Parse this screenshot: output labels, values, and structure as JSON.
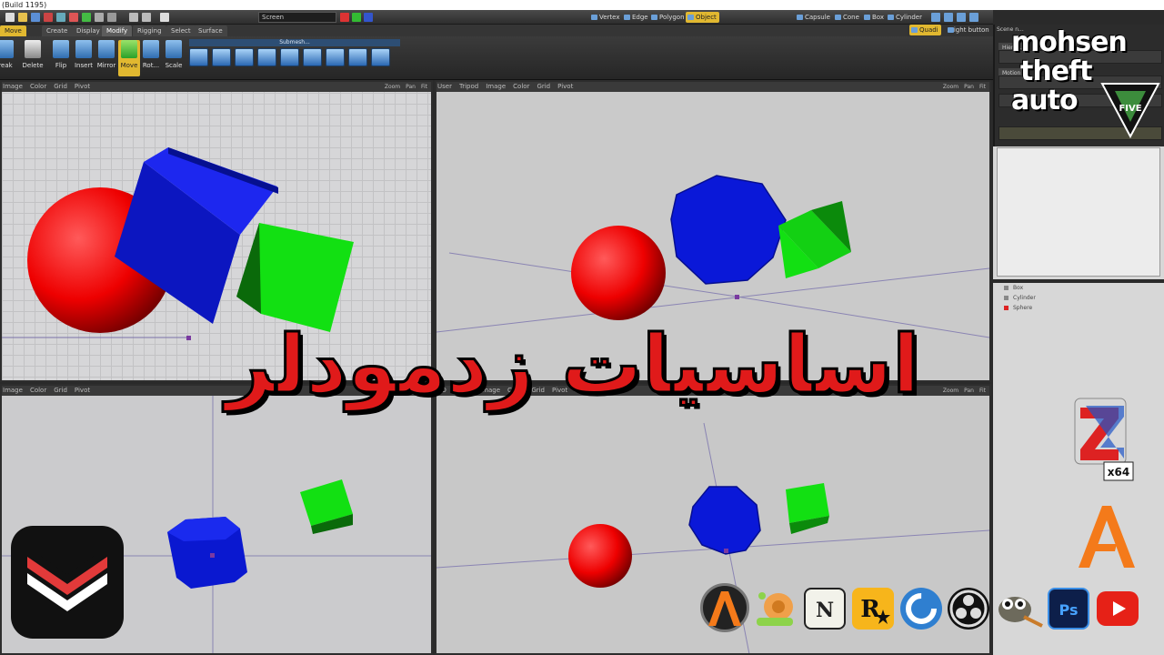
{
  "window": {
    "title": "(Build 1195)"
  },
  "toolbar": {
    "screen_select": "Screen",
    "buttons": [
      "Vertex",
      "Edge",
      "Polygon",
      "Object"
    ],
    "primitives": [
      "Capsule",
      "Cone",
      "Box",
      "Cylinder"
    ],
    "active": "Object",
    "quad_label": "Quadi",
    "right_button_label": "Right button"
  },
  "tabs": [
    "Move",
    "Create",
    "Display",
    "Modify",
    "Rigging",
    "Select",
    "Surface"
  ],
  "ribbon": {
    "tools": [
      "reak",
      "Delete",
      "Flip",
      "Insert",
      "Mirror",
      "Move",
      "Rot...",
      "Scale"
    ],
    "submesh_label": "Submesh..."
  },
  "viewports": {
    "top_left": {
      "items": [
        "Image",
        "Color",
        "Grid",
        "Pivot"
      ]
    },
    "top_right": {
      "items": [
        "User",
        "Tripod",
        "Image",
        "Color",
        "Grid",
        "Pivot"
      ]
    },
    "bottom_left": {
      "items": [
        "Image",
        "Color",
        "Grid",
        "Pivot"
      ]
    },
    "bottom_right": {
      "items": [
        "3D",
        "Tripod",
        "Image",
        "Color",
        "Grid",
        "Pivot"
      ]
    },
    "nav": [
      "Zoom",
      "Pan",
      "Fit"
    ]
  },
  "right_panel": {
    "header": "Scene n...",
    "tabs": [
      "Hierar...",
      "Motion"
    ],
    "scene_items": [
      "Box",
      "Cylinder",
      "Sphere"
    ]
  },
  "logo": {
    "line1": "mohsen",
    "line2": "theft",
    "line3": "auto",
    "badge": "FIVE"
  },
  "banner": "اساسیات زدمودلر",
  "zmodeler_badge": "x64",
  "colors": {
    "sphere": "#e01010",
    "cylinder": "#0a12d8",
    "box": "#10d010",
    "accent": "#e1b830"
  },
  "dock_icons": [
    "zmodeler-fiv-icon",
    "snail-icon",
    "nv-icon",
    "rockstar-icon",
    "ccleaner-icon",
    "obs-icon",
    "gimp-icon",
    "photoshop-icon",
    "youtube-icon"
  ]
}
